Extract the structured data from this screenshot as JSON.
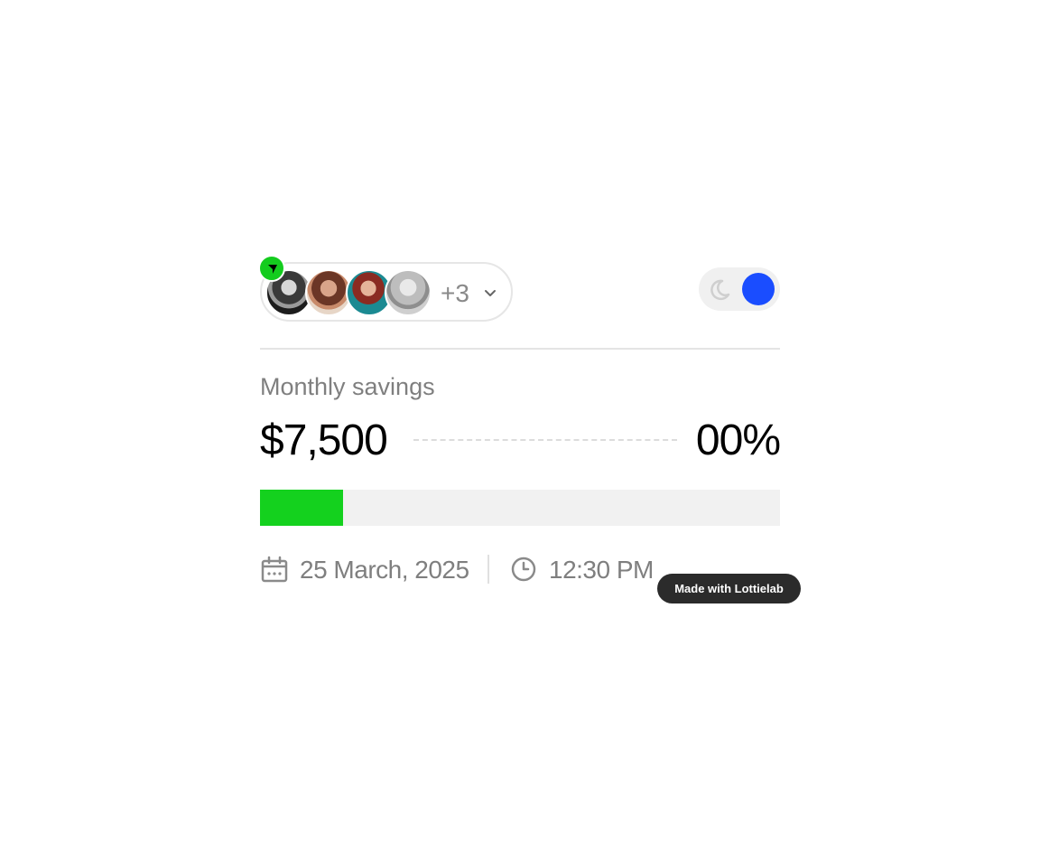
{
  "users": {
    "avatars": [
      "user-avatar-1",
      "user-avatar-2",
      "user-avatar-3",
      "user-avatar-4"
    ],
    "more_count": "+3",
    "expand_icon": "chevron-down-icon",
    "badge_icon": "cursor-arrow-icon",
    "badge_color": "#14cc1e"
  },
  "theme_toggle": {
    "icon": "moon-icon",
    "knob_color": "#1a4dff",
    "state": "on"
  },
  "savings": {
    "title": "Monthly savings",
    "amount": "$7,500",
    "percent": "00%",
    "progress_fraction": 0.16,
    "progress_color": "#14d11e"
  },
  "meta": {
    "date_icon": "calendar-icon",
    "date": "25 March, 2025",
    "time_icon": "clock-icon",
    "time": "12:30 PM"
  },
  "footer_badge": {
    "label": "Made with Lottielab"
  }
}
